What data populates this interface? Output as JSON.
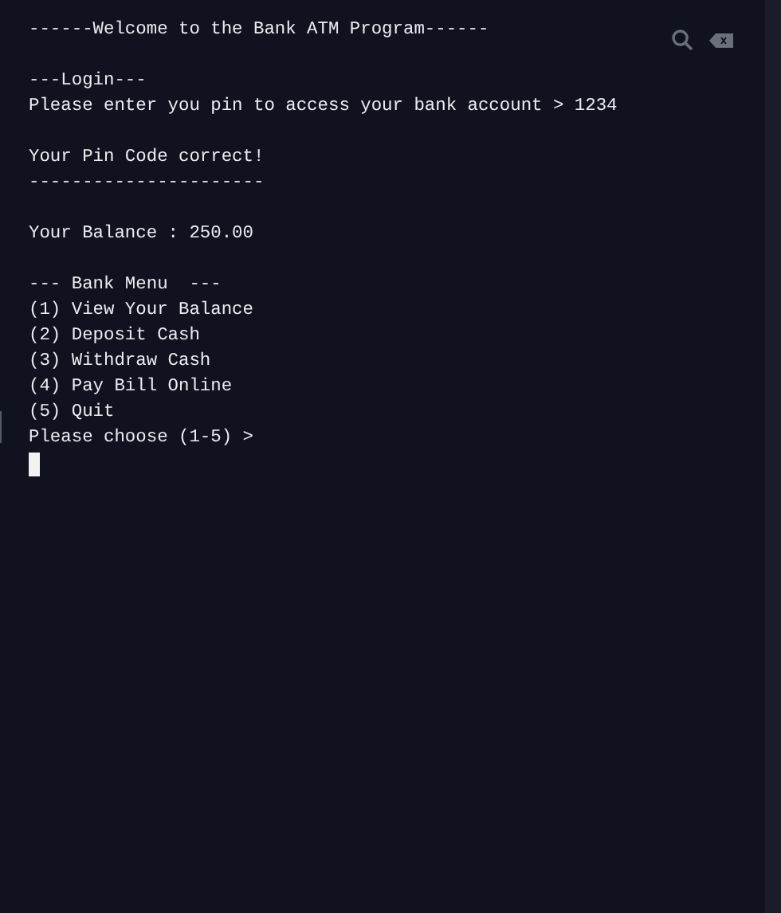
{
  "console": {
    "blocks": [
      {
        "lines": [
          "------Welcome to the Bank ATM Program------"
        ]
      },
      {
        "lines": [
          "---Login---",
          "Please enter you pin to access your bank account > 1234"
        ]
      },
      {
        "lines": [
          "Your Pin Code correct!",
          "----------------------"
        ]
      },
      {
        "lines": [
          "Your Balance : 250.00"
        ]
      },
      {
        "lines": [
          "--- Bank Menu  ---",
          "(1) View Your Balance",
          "(2) Deposit Cash",
          "(3) Withdraw Cash",
          "(4) Pay Bill Online",
          "(5) Quit",
          "Please choose (1-5) >"
        ]
      }
    ]
  }
}
